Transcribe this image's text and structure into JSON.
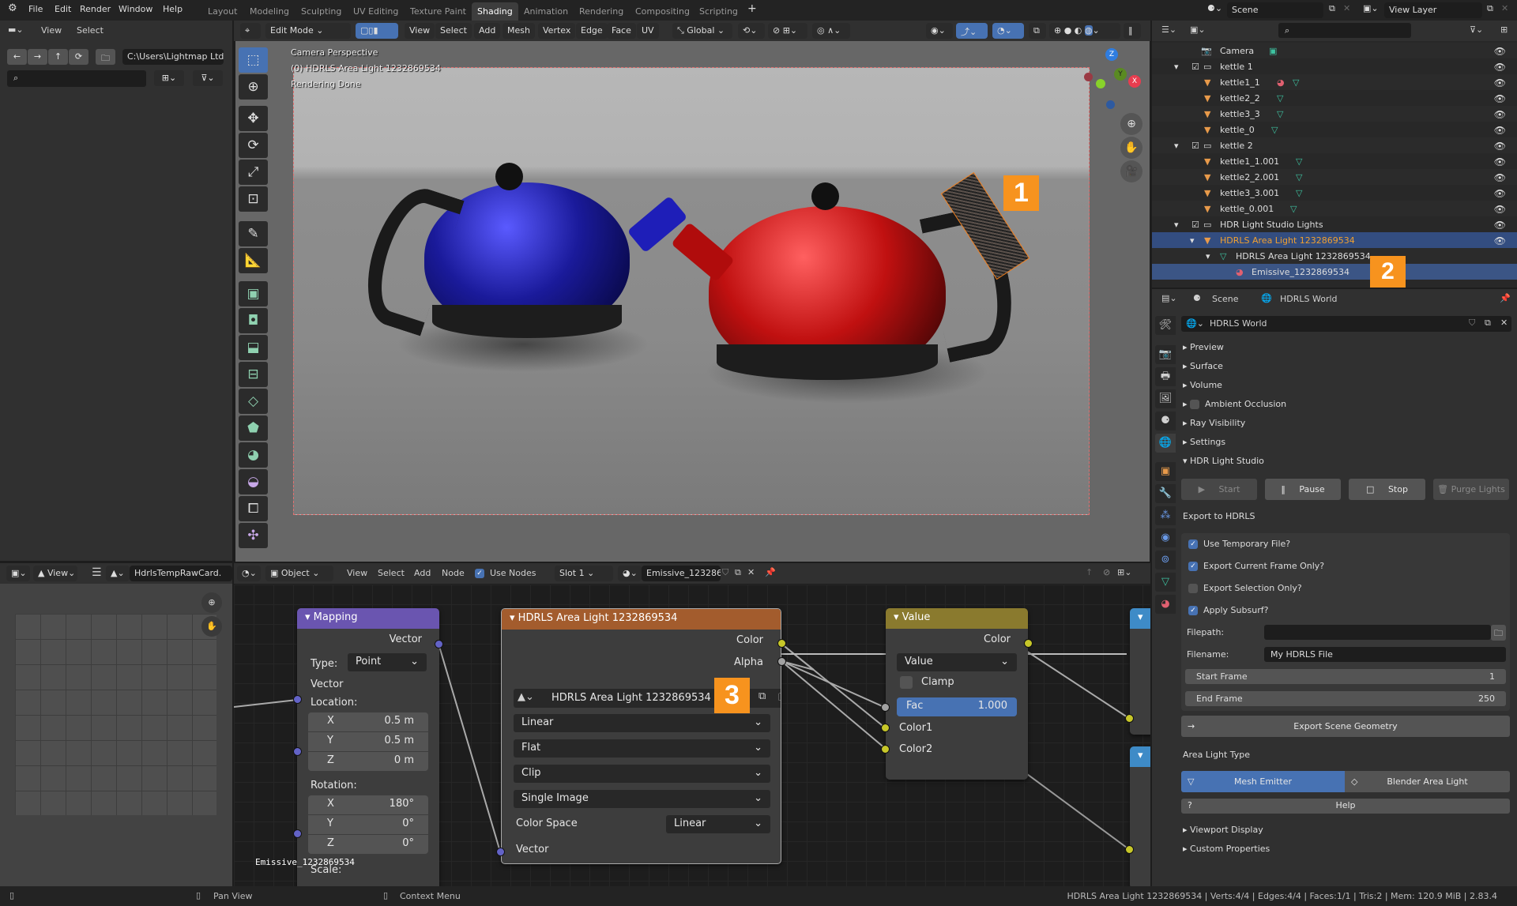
{
  "menubar": {
    "items": [
      "File",
      "Edit",
      "Render",
      "Window",
      "Help"
    ],
    "workspaces": [
      "Layout",
      "Modeling",
      "Sculpting",
      "UV Editing",
      "Texture Paint",
      "Shading",
      "Animation",
      "Rendering",
      "Compositing",
      "Scripting"
    ],
    "active_workspace": "Shading",
    "add_workspace": "+",
    "scene": "Scene",
    "view_layer": "View Layer"
  },
  "file_browser": {
    "menu": [
      "View",
      "Select"
    ],
    "path": "C:\\Users\\Lightmap Ltd\\",
    "search_placeholder": ""
  },
  "viewport": {
    "mode": "Edit Mode",
    "menu": [
      "View",
      "Select",
      "Add",
      "Mesh",
      "Vertex",
      "Edge",
      "Face",
      "UV"
    ],
    "orientation": "Global",
    "overlay_lines": [
      "Camera Perspective",
      "(0) HDRLS Area Light 1232869534",
      "Rendering Done"
    ],
    "gizmo_axes": [
      "Z",
      "Y",
      "X"
    ],
    "annotation": "1"
  },
  "outliner": {
    "search_placeholder": "",
    "rows": [
      {
        "label": "Camera",
        "type": "camera"
      },
      {
        "label": "kettle 1",
        "type": "collection"
      },
      {
        "label": "kettle1_1",
        "type": "mesh",
        "material": true
      },
      {
        "label": "kettle2_2",
        "type": "mesh"
      },
      {
        "label": "kettle3_3",
        "type": "mesh"
      },
      {
        "label": "kettle_0",
        "type": "mesh"
      },
      {
        "label": "kettle 2",
        "type": "collection"
      },
      {
        "label": "kettle1_1.001",
        "type": "mesh"
      },
      {
        "label": "kettle2_2.001",
        "type": "mesh"
      },
      {
        "label": "kettle3_3.001",
        "type": "mesh"
      },
      {
        "label": "kettle_0.001",
        "type": "mesh"
      },
      {
        "label": "HDR Light Studio Lights",
        "type": "collection"
      },
      {
        "label": "HDRLS Area Light 1232869534",
        "type": "object-selected"
      },
      {
        "label": "HDRLS Area Light 1232869534",
        "type": "meshdata"
      },
      {
        "label": "Emissive_1232869534",
        "type": "material-selected"
      }
    ],
    "annotation": "2"
  },
  "properties": {
    "breadcrumb": [
      "Scene",
      "HDRLS World"
    ],
    "world_name": "HDRLS World",
    "panels": [
      "Preview",
      "Surface",
      "Volume",
      "Ambient Occlusion",
      "Ray Visibility",
      "Settings",
      "HDR Light Studio"
    ],
    "hdrls": {
      "buttons": [
        "Start",
        "Pause",
        "Stop",
        "Purge Lights"
      ],
      "export_title": "Export to HDRLS",
      "checkboxes": [
        {
          "label": "Use Temporary File?",
          "checked": true
        },
        {
          "label": "Export Current Frame Only?",
          "checked": true
        },
        {
          "label": "Export Selection Only?",
          "checked": false
        },
        {
          "label": "Apply Subsurf?",
          "checked": true
        }
      ],
      "filepath_label": "Filepath:",
      "filepath_value": "",
      "filename_label": "Filename:",
      "filename_value": "My HDRLS File",
      "start_frame_label": "Start Frame",
      "start_frame": "1",
      "end_frame_label": "End Frame",
      "end_frame": "250",
      "export_geometry": "Export Scene Geometry",
      "area_light_type_label": "Area Light Type",
      "area_light_types": [
        "Mesh Emitter",
        "Blender Area Light"
      ],
      "active_type": "Mesh Emitter",
      "help": "Help"
    },
    "extra_panels": [
      "Viewport Display",
      "Custom Properties"
    ]
  },
  "image_editor": {
    "view": "View",
    "image_name": "HdrlsTempRawCard."
  },
  "node_editor": {
    "object_mode": "Object",
    "menu": [
      "View",
      "Select",
      "Add",
      "Node"
    ],
    "use_nodes_label": "Use Nodes",
    "use_nodes": true,
    "slot": "Slot 1",
    "material": "Emissive_1232869...",
    "frame_label": "Emissive_1232869534",
    "mapping": {
      "title": "Mapping",
      "output": "Vector",
      "type_label": "Type:",
      "type_value": "Point",
      "input": "Vector",
      "location_label": "Location:",
      "location": [
        [
          "X",
          "0.5 m"
        ],
        [
          "Y",
          "0.5 m"
        ],
        [
          "Z",
          "0 m"
        ]
      ],
      "rotation_label": "Rotation:",
      "rotation": [
        [
          "X",
          "180°"
        ],
        [
          "Y",
          "0°"
        ],
        [
          "Z",
          "0°"
        ]
      ],
      "scale_label": "Scale:"
    },
    "image_node": {
      "title": "HDRLS Area Light 1232869534",
      "outputs": [
        "Color",
        "Alpha"
      ],
      "image": "HDRLS Area Light 1232869534",
      "interpolation": "Linear",
      "projection": "Flat",
      "extension": "Clip",
      "source": "Single Image",
      "color_space_label": "Color Space",
      "color_space": "Linear",
      "input": "Vector",
      "annotation": "3"
    },
    "value_node": {
      "title": "Value",
      "output": "Color",
      "blend": "Value",
      "clamp_label": "Clamp",
      "clamp": false,
      "fac_label": "Fac",
      "fac_value": "1.000",
      "inputs": [
        "Color1",
        "Color2"
      ]
    }
  },
  "statusbar": {
    "hints": [
      "Pan View",
      "Context Menu"
    ],
    "info": "HDRLS Area Light 1232869534 | Verts:4/4 | Edges:4/4 | Faces:1/1 | Tris:2 | Mem: 120.9 MiB | 2.83.4"
  },
  "colors": {
    "accent": "#4772b3",
    "annotation": "#f7931e",
    "mapping_header": "#6a55b0",
    "image_header": "#a35c2d",
    "value_header": "#8a7a2e",
    "kettle_blue": "#1a1a9a",
    "kettle_red": "#c01010"
  }
}
